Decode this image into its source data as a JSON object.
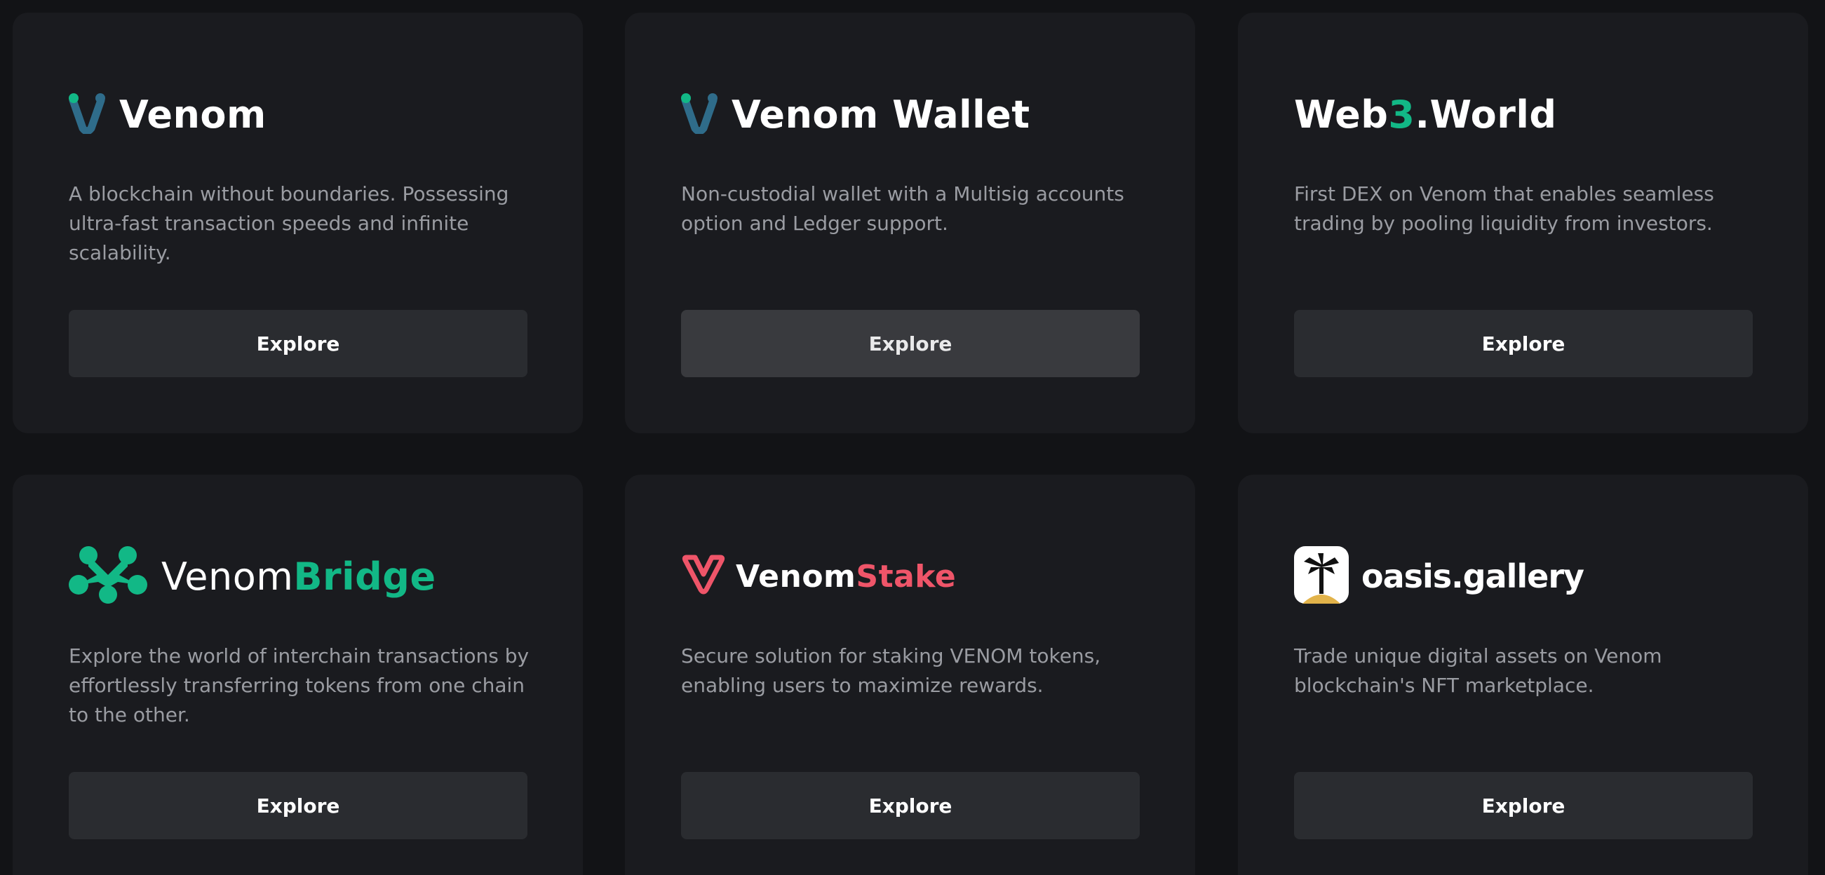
{
  "colors": {
    "page_bg": "#121316",
    "card_bg": "#1a1b1f",
    "button_bg": "#2a2c30",
    "button_hover_bg": "#393a3e",
    "text_primary": "#ffffff",
    "text_muted": "#9a9ca2",
    "accent_green": "#12b886",
    "accent_red": "#ef5569",
    "venom_teal": "#2f6c8a",
    "oasis_sand": "#e2b34a"
  },
  "cards": [
    {
      "logo_icon": "venom-v-icon",
      "logo_text": "Venom",
      "description": "A blockchain without boundaries. Possessing ultra-fast transaction speeds and infinite scalability.",
      "button_label": "Explore"
    },
    {
      "logo_icon": "venom-v-icon",
      "logo_text": "Venom Wallet",
      "description": "Non-custodial wallet with a Multisig accounts option and Ledger support.",
      "button_label": "Explore",
      "button_state": "hover"
    },
    {
      "logo_text_part1": "Web",
      "logo_text_part2": "3",
      "logo_text_part3": ".World",
      "description": "First DEX on Venom that enables seamless trading by pooling liquidity from investors.",
      "button_label": "Explore"
    },
    {
      "logo_icon": "venom-bridge-icon",
      "logo_text_part1": "Venom",
      "logo_text_part2": "Bridge",
      "description": "Explore the world of interchain transactions by effortlessly transferring tokens from one chain to the other.",
      "button_label": "Explore"
    },
    {
      "logo_icon": "venom-stake-icon",
      "logo_text_part1": "Venom",
      "logo_text_part2": "Stake",
      "description": "Secure solution for staking VENOM tokens, enabling users to maximize rewards.",
      "button_label": "Explore"
    },
    {
      "logo_icon": "palm-tree-icon",
      "logo_text": "oasis.gallery",
      "description": "Trade unique digital assets on Venom blockchain's NFT marketplace.",
      "button_label": "Explore"
    }
  ]
}
